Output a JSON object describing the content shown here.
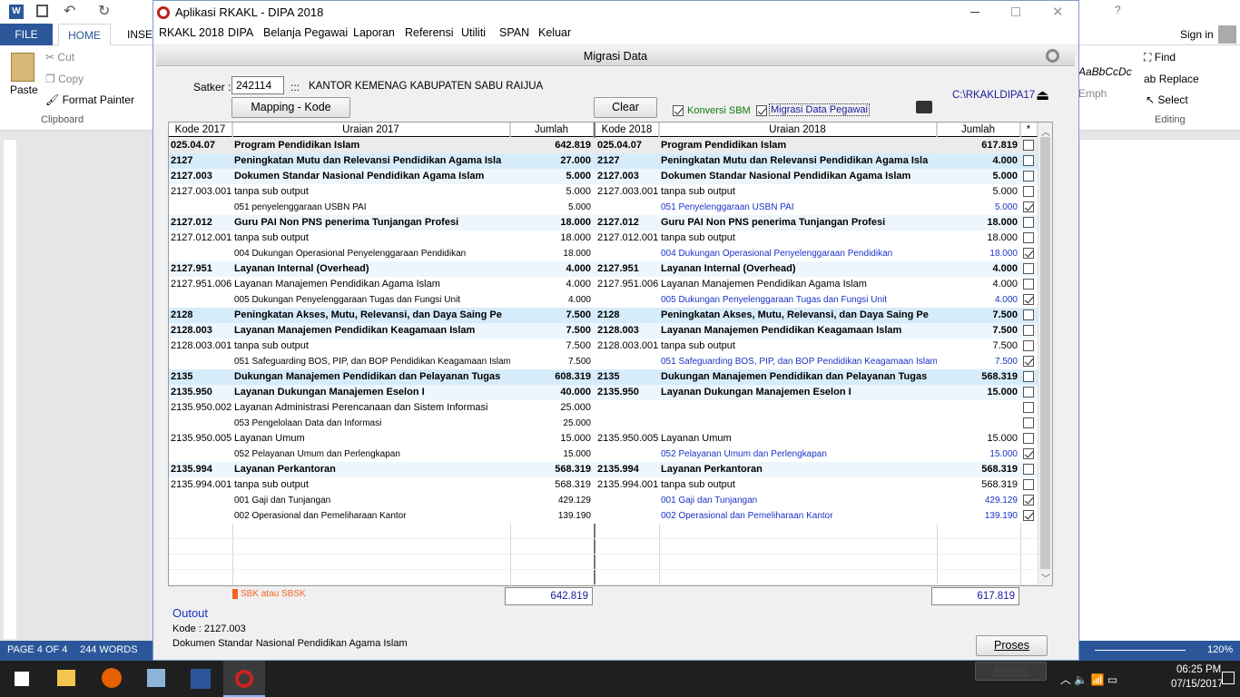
{
  "word": {
    "tabs": [
      "FILE",
      "HOME",
      "INSE"
    ],
    "clipboard": {
      "paste": "Paste",
      "cut": "Cut",
      "copy": "Copy",
      "format_painter": "Format Painter",
      "group": "Clipboard"
    },
    "editing": {
      "find": "Find",
      "replace": "Replace",
      "select": "Select",
      "group": "Editing"
    },
    "styles": [
      "AaBbCcDc",
      "Emphasis"
    ],
    "sign_in": "Sign in",
    "status": {
      "page": "PAGE 4 OF 4",
      "words": "244 WORDS",
      "zoom": "120%"
    }
  },
  "taskbar": {
    "time": "06:25 PM",
    "date": "07/15/2017"
  },
  "app": {
    "title": "Aplikasi RKAKL - DIPA 2018",
    "menu": [
      "RKAKL 2018",
      "DIPA",
      "Belanja Pegawai",
      "Laporan",
      "Referensi",
      "Utiliti",
      "SPAN",
      "Keluar"
    ],
    "dialog_title": "Migrasi Data",
    "satker_label": "Satker :",
    "satker_code": "242114",
    "satker_sep": ":::",
    "satker_name": "KANTOR KEMENAG KABUPATEN SABU RAIJUA",
    "mapping_button": "Mapping - Kode",
    "clear_button": "Clear",
    "konversi_sbm": "Konversi SBM",
    "migrasi_pegawai": "Migrasi Data Pegawai",
    "path": "C:\\RKAKLDIPA17",
    "headers": {
      "kode2017": "Kode 2017",
      "uraian2017": "Uraian 2017",
      "jumlah": "Jumlah",
      "kode2018": "Kode 2018",
      "uraian2018": "Uraian 2018",
      "star": "*"
    },
    "rows": [
      {
        "t": "prog",
        "k1": "025.04.07",
        "u1": "Program Pendidikan Islam",
        "j1": "642.819",
        "k2": "025.04.07",
        "u2": "Program Pendidikan Islam",
        "j2": "617.819",
        "chk": false
      },
      {
        "t": "kro",
        "k1": "2127",
        "u1": "Peningkatan Mutu dan Relevansi Pendidikan Agama Isla",
        "j1": "27.000",
        "k2": "2127",
        "u2": "Peningkatan Mutu dan Relevansi Pendidikan Agama Isla",
        "j2": "4.000",
        "chk": false
      },
      {
        "t": "out",
        "k1": "2127.003",
        "u1": "Dokumen Standar Nasional Pendidikan Agama Islam",
        "j1": "5.000",
        "k2": "2127.003",
        "u2": "Dokumen Standar Nasional Pendidikan Agama Islam",
        "j2": "5.000",
        "chk": false
      },
      {
        "t": "sub",
        "k1": "2127.003.001",
        "u1": "tanpa sub output",
        "j1": "5.000",
        "k2": "2127.003.001",
        "u2": "tanpa sub output",
        "j2": "5.000",
        "chk": false
      },
      {
        "t": "kmp",
        "k1": "",
        "u1": "051  penyelenggaraan USBN PAI",
        "j1": "5.000",
        "k2": "",
        "u2": "051  Penyelenggaraan USBN PAI",
        "j2": "5.000",
        "chk": true
      },
      {
        "t": "out",
        "k1": "2127.012",
        "u1": "Guru PAI Non PNS penerima Tunjangan Profesi",
        "j1": "18.000",
        "k2": "2127.012",
        "u2": "Guru PAI Non PNS penerima Tunjangan Profesi",
        "j2": "18.000",
        "chk": false
      },
      {
        "t": "sub",
        "k1": "2127.012.001",
        "u1": "tanpa sub output",
        "j1": "18.000",
        "k2": "2127.012.001",
        "u2": "tanpa sub output",
        "j2": "18.000",
        "chk": false
      },
      {
        "t": "kmp",
        "k1": "",
        "u1": "004  Dukungan Operasional Penyelenggaraan Pendidikan",
        "j1": "18.000",
        "k2": "",
        "u2": "004  Dukungan Operasional Penyelenggaraan Pendidikan",
        "j2": "18.000",
        "chk": true
      },
      {
        "t": "out",
        "k1": "2127.951",
        "u1": "Layanan Internal (Overhead)",
        "j1": "4.000",
        "k2": "2127.951",
        "u2": "Layanan Internal (Overhead)",
        "j2": "4.000",
        "chk": false
      },
      {
        "t": "sub",
        "k1": "2127.951.006",
        "u1": "Layanan Manajemen Pendidikan Agama Islam",
        "j1": "4.000",
        "k2": "2127.951.006",
        "u2": "Layanan Manajemen Pendidikan Agama Islam",
        "j2": "4.000",
        "chk": false
      },
      {
        "t": "kmp",
        "k1": "",
        "u1": "005  Dukungan Penyelenggaraan Tugas dan Fungsi Unit",
        "j1": "4.000",
        "k2": "",
        "u2": "005  Dukungan Penyelenggaraan Tugas dan Fungsi Unit",
        "j2": "4.000",
        "chk": true
      },
      {
        "t": "kro",
        "k1": "2128",
        "u1": "Peningkatan Akses, Mutu, Relevansi, dan Daya Saing Pe",
        "j1": "7.500",
        "k2": "2128",
        "u2": "Peningkatan Akses, Mutu, Relevansi, dan Daya Saing Pe",
        "j2": "7.500",
        "chk": false
      },
      {
        "t": "out",
        "k1": "2128.003",
        "u1": "Layanan Manajemen Pendidikan Keagamaan Islam",
        "j1": "7.500",
        "k2": "2128.003",
        "u2": "Layanan Manajemen Pendidikan Keagamaan Islam",
        "j2": "7.500",
        "chk": false
      },
      {
        "t": "sub",
        "k1": "2128.003.001",
        "u1": "tanpa sub output",
        "j1": "7.500",
        "k2": "2128.003.001",
        "u2": "tanpa sub output",
        "j2": "7.500",
        "chk": false
      },
      {
        "t": "kmp",
        "k1": "",
        "u1": "051  Safeguarding BOS, PIP, dan BOP Pendidikan Keagamaan Islam",
        "j1": "7.500",
        "k2": "",
        "u2": "051  Safeguarding BOS, PIP, dan BOP Pendidikan Keagamaan Islam",
        "j2": "7.500",
        "chk": true
      },
      {
        "t": "kro",
        "k1": "2135",
        "u1": "Dukungan Manajemen Pendidikan dan Pelayanan Tugas",
        "j1": "608.319",
        "k2": "2135",
        "u2": "Dukungan Manajemen Pendidikan dan Pelayanan Tugas",
        "j2": "568.319",
        "chk": false
      },
      {
        "t": "out",
        "k1": "2135.950",
        "u1": "Layanan Dukungan Manajemen Eselon I",
        "j1": "40.000",
        "k2": "2135.950",
        "u2": "Layanan Dukungan Manajemen Eselon I",
        "j2": "15.000",
        "chk": false
      },
      {
        "t": "sub",
        "k1": "2135.950.002",
        "u1": "Layanan Administrasi Perencanaan dan Sistem Informasi",
        "j1": "25.000",
        "k2": "",
        "u2": "",
        "j2": "",
        "chk": false
      },
      {
        "t": "kmp",
        "k1": "",
        "u1": "053  Pengelolaan Data dan Informasi",
        "j1": "25.000",
        "k2": "",
        "u2": "",
        "j2": "",
        "chk": false
      },
      {
        "t": "sub",
        "k1": "2135.950.005",
        "u1": "Layanan Umum",
        "j1": "15.000",
        "k2": "2135.950.005",
        "u2": "Layanan Umum",
        "j2": "15.000",
        "chk": false
      },
      {
        "t": "kmp",
        "k1": "",
        "u1": "052  Pelayanan Umum dan Perlengkapan",
        "j1": "15.000",
        "k2": "",
        "u2": "052  Pelayanan Umum dan Perlengkapan",
        "j2": "15.000",
        "chk": true
      },
      {
        "t": "out",
        "k1": "2135.994",
        "u1": "Layanan Perkantoran",
        "j1": "568.319",
        "k2": "2135.994",
        "u2": "Layanan Perkantoran",
        "j2": "568.319",
        "chk": false
      },
      {
        "t": "sub",
        "k1": "2135.994.001",
        "u1": "tanpa sub output",
        "j1": "568.319",
        "k2": "2135.994.001",
        "u2": "tanpa sub output",
        "j2": "568.319",
        "chk": false
      },
      {
        "t": "kmp",
        "k1": "",
        "u1": "001  Gaji dan Tunjangan",
        "j1": "429.129",
        "k2": "",
        "u2": "001  Gaji dan Tunjangan",
        "j2": "429.129",
        "chk": true
      },
      {
        "t": "kmp",
        "k1": "",
        "u1": "002  Operasional dan Pemeliharaan Kantor",
        "j1": "139.190",
        "k2": "",
        "u2": "002  Operasional dan Pemeliharaan Kantor",
        "j2": "139.190",
        "chk": true
      }
    ],
    "sbk_label": "SBK atau SBSK",
    "total_2017": "642.819",
    "total_2018": "617.819",
    "outout_label": "Outout",
    "kode_line": "Kode : 2127.003",
    "desc_line": "Dokumen Standar Nasional Pendidikan Agama Islam",
    "proses_button": "Proses",
    "keluar_button": "Keluar"
  }
}
